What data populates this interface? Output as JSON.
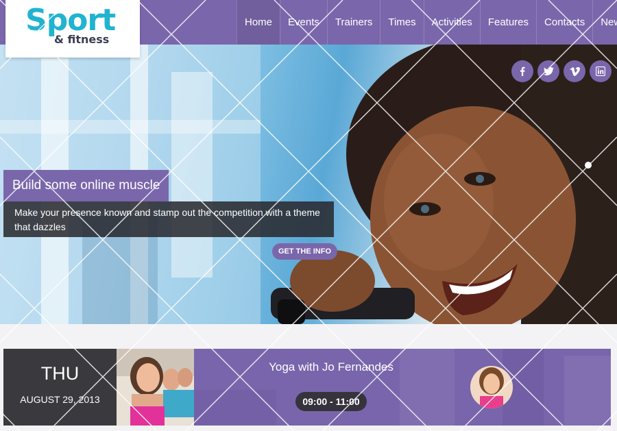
{
  "logo": {
    "main": "Sport",
    "sub": "& fitness"
  },
  "nav": {
    "items": [
      {
        "label": "Home"
      },
      {
        "label": "Events"
      },
      {
        "label": "Trainers"
      },
      {
        "label": "Times"
      },
      {
        "label": "Activities"
      },
      {
        "label": "Features"
      },
      {
        "label": "Contacts"
      },
      {
        "label": "News"
      }
    ]
  },
  "social": {
    "icons": [
      "facebook-icon",
      "twitter-icon",
      "vimeo-icon",
      "linkedin-icon"
    ]
  },
  "hero": {
    "title": "Build some online muscle",
    "text": "Make your presence known and stamp out the competition with a theme that dazzles",
    "button": "GET THE INFO"
  },
  "event": {
    "day": "THU",
    "date": "AUGUST 29, 2013",
    "title": "Yoga with Jo Fernandes",
    "time": "09:00 - 11:00",
    "prev_icon": "chevron-double-left-icon",
    "next_icon": "chevron-double-right-icon"
  },
  "colors": {
    "brand": "#7a66ab",
    "logo_accent": "#21b3cf",
    "dark": "#3a3a3e"
  }
}
